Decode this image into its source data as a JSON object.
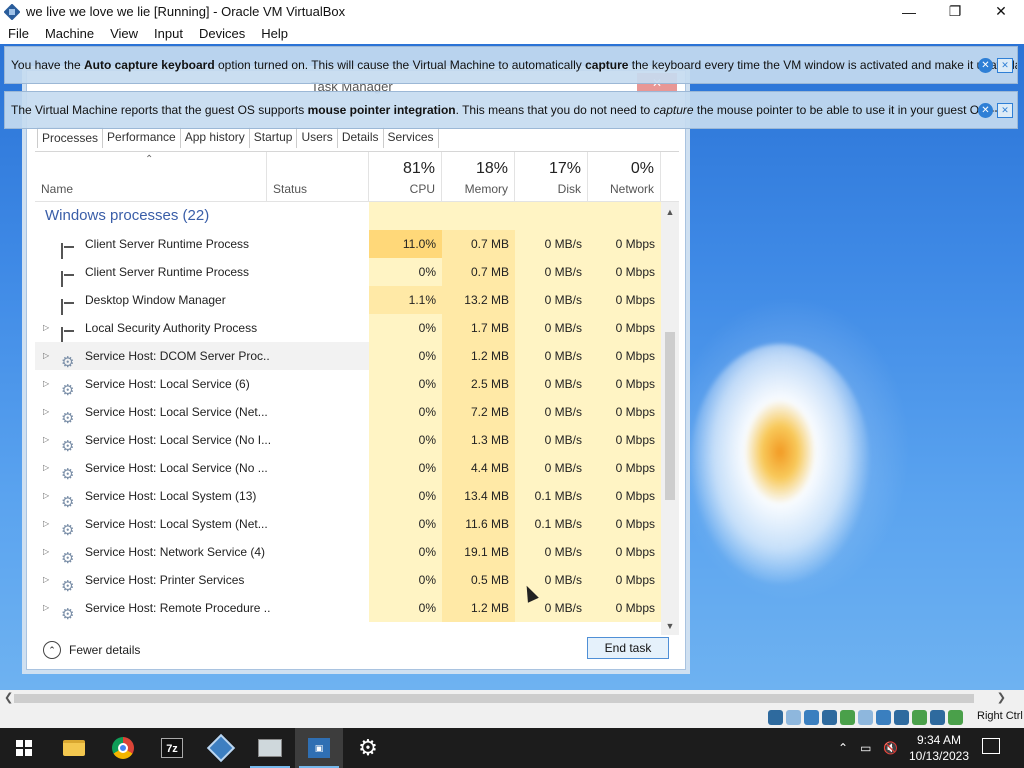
{
  "window": {
    "title": "we live we love we lie [Running] - Oracle VM VirtualBox"
  },
  "menu": [
    "File",
    "Machine",
    "View",
    "Input",
    "Devices",
    "Help"
  ],
  "notices": [
    {
      "pre": "You have the ",
      "bold1": "Auto capture keyboard",
      "mid": " option turned on. This will cause the Virtual Machine to automatically ",
      "bold2": "capture",
      "post": " the keyboard every time the VM window is activated and make it unavailable to"
    },
    {
      "pre": "The Virtual Machine reports that the guest OS supports ",
      "bold1": "mouse pointer integration",
      "mid": ". This means that you do not need to ",
      "italic": "capture",
      "post": " the mouse pointer to be able to use it in your guest OS -- all mouse"
    }
  ],
  "task_manager": {
    "title": "Task Manager",
    "tabs": [
      "Processes",
      "Performance",
      "App history",
      "Startup",
      "Users",
      "Details",
      "Services"
    ],
    "active_tab": "Processes",
    "columns": {
      "name": "Name",
      "status": "Status",
      "cpu_pct": "81%",
      "cpu": "CPU",
      "mem_pct": "18%",
      "mem": "Memory",
      "disk_pct": "17%",
      "disk": "Disk",
      "net_pct": "0%",
      "net": "Network"
    },
    "group": "Windows processes (22)",
    "rows": [
      {
        "name": "Client Server Runtime Process",
        "icon": "app-window-icon",
        "expandable": false,
        "cpu": "11.0%",
        "mem": "0.7 MB",
        "disk": "0 MB/s",
        "net": "0 Mbps",
        "cpu_heat": 2
      },
      {
        "name": "Client Server Runtime Process",
        "icon": "app-window-icon",
        "expandable": false,
        "cpu": "0%",
        "mem": "0.7 MB",
        "disk": "0 MB/s",
        "net": "0 Mbps",
        "cpu_heat": 0
      },
      {
        "name": "Desktop Window Manager",
        "icon": "app-window-icon",
        "expandable": false,
        "cpu": "1.1%",
        "mem": "13.2 MB",
        "disk": "0 MB/s",
        "net": "0 Mbps",
        "cpu_heat": 1
      },
      {
        "name": "Local Security Authority Process",
        "icon": "app-window-icon",
        "expandable": true,
        "cpu": "0%",
        "mem": "1.7 MB",
        "disk": "0 MB/s",
        "net": "0 Mbps",
        "cpu_heat": 0
      },
      {
        "name": "Service Host: DCOM Server Proc...",
        "icon": "gear-icon",
        "expandable": true,
        "cpu": "0%",
        "mem": "1.2 MB",
        "disk": "0 MB/s",
        "net": "0 Mbps",
        "cpu_heat": 0
      },
      {
        "name": "Service Host: Local Service (6)",
        "icon": "gear-icon",
        "expandable": true,
        "cpu": "0%",
        "mem": "2.5 MB",
        "disk": "0 MB/s",
        "net": "0 Mbps",
        "cpu_heat": 0
      },
      {
        "name": "Service Host: Local Service (Net...",
        "icon": "gear-icon",
        "expandable": true,
        "cpu": "0%",
        "mem": "7.2 MB",
        "disk": "0 MB/s",
        "net": "0 Mbps",
        "cpu_heat": 0
      },
      {
        "name": "Service Host: Local Service (No I...",
        "icon": "gear-icon",
        "expandable": true,
        "cpu": "0%",
        "mem": "1.3 MB",
        "disk": "0 MB/s",
        "net": "0 Mbps",
        "cpu_heat": 0
      },
      {
        "name": "Service Host: Local Service (No ...",
        "icon": "gear-icon",
        "expandable": true,
        "cpu": "0%",
        "mem": "4.4 MB",
        "disk": "0 MB/s",
        "net": "0 Mbps",
        "cpu_heat": 0
      },
      {
        "name": "Service Host: Local System (13)",
        "icon": "gear-icon",
        "expandable": true,
        "cpu": "0%",
        "mem": "13.4 MB",
        "disk": "0.1 MB/s",
        "net": "0 Mbps",
        "cpu_heat": 0
      },
      {
        "name": "Service Host: Local System (Net...",
        "icon": "gear-icon",
        "expandable": true,
        "cpu": "0%",
        "mem": "11.6 MB",
        "disk": "0.1 MB/s",
        "net": "0 Mbps",
        "cpu_heat": 0
      },
      {
        "name": "Service Host: Network Service (4)",
        "icon": "gear-icon",
        "expandable": true,
        "cpu": "0%",
        "mem": "19.1 MB",
        "disk": "0 MB/s",
        "net": "0 Mbps",
        "cpu_heat": 0
      },
      {
        "name": "Service Host: Printer Services",
        "icon": "gear-icon",
        "expandable": true,
        "cpu": "0%",
        "mem": "0.5 MB",
        "disk": "0 MB/s",
        "net": "0 Mbps",
        "cpu_heat": 0
      },
      {
        "name": "Service Host: Remote Procedure ...",
        "icon": "gear-icon",
        "expandable": true,
        "cpu": "0%",
        "mem": "1.2 MB",
        "disk": "0 MB/s",
        "net": "0 Mbps",
        "cpu_heat": 0
      }
    ],
    "fewer_details": "Fewer details",
    "end_task": "End task"
  },
  "statusbar": {
    "host_key": "Right Ctrl"
  },
  "taskbar": {
    "items": [
      "start-icon",
      "file-explorer-icon",
      "chrome-icon",
      "7zip-icon",
      "virtualbox-icon",
      "photos-icon",
      "virtualbox-vm-icon",
      "settings-icon"
    ],
    "time": "9:34 AM",
    "date": "10/13/2023"
  },
  "colors": {
    "accent": "#3a5ea8",
    "heat_low": "#fff4c4",
    "heat_mid": "#ffe9a6",
    "heat_high": "#ffd879"
  }
}
